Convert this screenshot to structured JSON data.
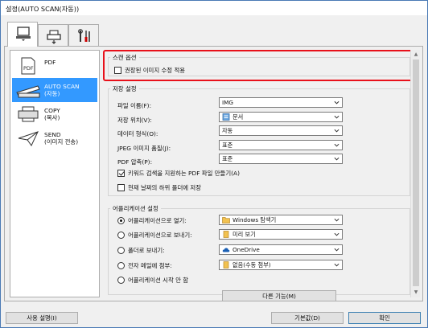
{
  "window": {
    "title": "설정(AUTO SCAN(자동))"
  },
  "tabs": [
    {
      "icon": "computer-scan-icon",
      "active": true
    },
    {
      "icon": "scanner-settings-icon",
      "active": false
    },
    {
      "icon": "tools-icon",
      "active": false
    }
  ],
  "sidebar": {
    "items": [
      {
        "label": "PDF",
        "icon": "pdf-document-icon",
        "selected": false
      },
      {
        "label": "AUTO SCAN\n(자동)",
        "icon": "auto-scan-icon",
        "selected": true
      },
      {
        "label": "COPY\n(복사)",
        "icon": "copy-printer-icon",
        "selected": false
      },
      {
        "label": "SEND\n(이미지 전송)",
        "icon": "send-plane-icon",
        "selected": false
      }
    ]
  },
  "scan_options": {
    "title": "스캔 옵션",
    "apply_recommended_label": "권장된 이미지 수정 적용",
    "apply_recommended_checked": false
  },
  "save_settings": {
    "title": "저장 설정",
    "file_name_label": "파일 이름(F):",
    "file_name_value": "IMG",
    "save_in_label": "저장 위치(V):",
    "save_in_value": "문서",
    "data_format_label": "데이터 형식(O):",
    "data_format_value": "자동",
    "jpeg_quality_label": "JPEG 이미지 품질(J):",
    "jpeg_quality_value": "표준",
    "pdf_compression_label": "PDF 압축(P):",
    "pdf_compression_value": "표준",
    "keyword_pdf_label": "키워드 검색을 지원하는 PDF 파일 만들기(A)",
    "keyword_pdf_checked": true,
    "date_subfolder_label": "현재 날짜의 하위 폴더에 저장",
    "date_subfolder_checked": false
  },
  "app_settings": {
    "title": "어플리케이션 설정",
    "open_with_label": "어플리케이션으로 열기:",
    "open_with_value": "Windows 탐색기",
    "open_with_selected": true,
    "send_to_app_label": "어플리케이션으로 보내기:",
    "send_to_app_value": "미리 보기",
    "send_to_folder_label": "폴더로 보내기:",
    "send_to_folder_value": "OneDrive",
    "email_label": "전자 메일에 첨부:",
    "email_value": "없음(수동 첨부)",
    "no_start_label": "어플리케이션 시작 안 함",
    "more_functions_label": "다른 기능(M)"
  },
  "footer": {
    "instructions_label": "사용 설명(I)",
    "defaults_label": "기본값(D)",
    "ok_label": "확인"
  },
  "colors": {
    "highlight": "#e8101a",
    "selection": "#3399ff"
  }
}
